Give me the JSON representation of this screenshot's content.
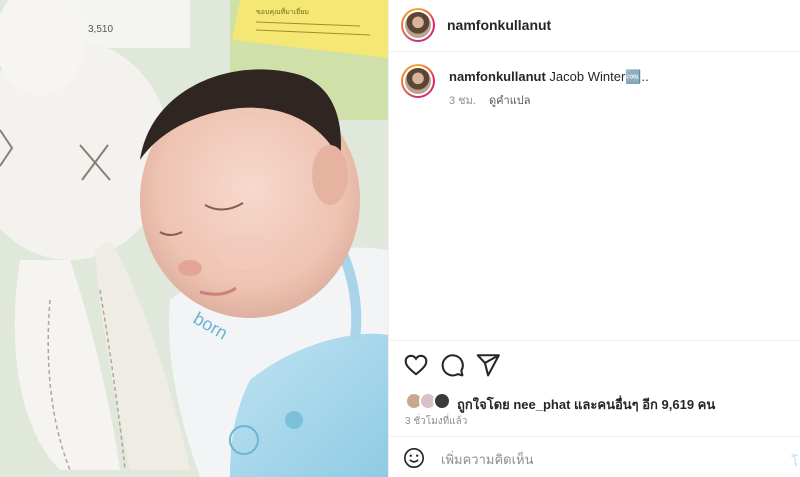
{
  "post": {
    "username": "namfonkullanut",
    "caption_text": "Jacob Winter🆒..",
    "caption_age": "3 ชม.",
    "see_translation": "ดูคำแปล"
  },
  "likes": {
    "text": "ถูกใจโดย nee_phat และคนอื่นๆ อีก 9,619 คน",
    "timestamp": "3 ชั่วโมงที่แล้ว"
  },
  "comment": {
    "placeholder": "เพิ่มความคิดเห็น",
    "post_label": "โ"
  },
  "photo": {
    "sticker_text": "ขอบคุณที่มาเยี่ยม",
    "card_number": "3,510",
    "tag_word": "born"
  },
  "icons": [
    "heart-icon",
    "comment-icon",
    "share-icon",
    "emoji-icon"
  ],
  "colors": {
    "story_ring": "#e91e63",
    "post_button": "#b3dbff",
    "muted_text": "#8e8e8e"
  }
}
